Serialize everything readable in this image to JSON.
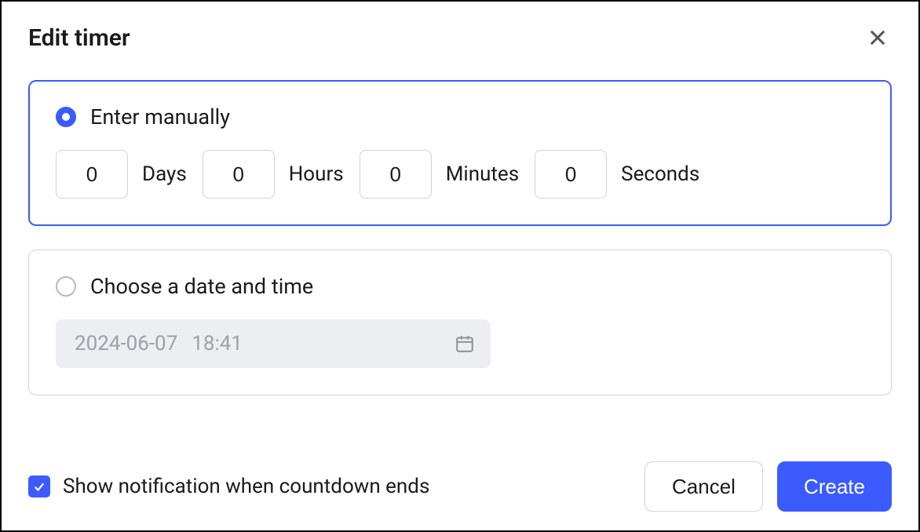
{
  "dialog": {
    "title": "Edit timer"
  },
  "manual": {
    "label": "Enter manually",
    "selected": true,
    "days": {
      "value": "0",
      "label": "Days"
    },
    "hours": {
      "value": "0",
      "label": "Hours"
    },
    "minutes": {
      "value": "0",
      "label": "Minutes"
    },
    "seconds": {
      "value": "0",
      "label": "Seconds"
    }
  },
  "datetime": {
    "label": "Choose a date and time",
    "selected": false,
    "date": "2024-06-07",
    "time": "18:41"
  },
  "notification": {
    "label": "Show notification when countdown ends",
    "checked": true
  },
  "buttons": {
    "cancel": "Cancel",
    "create": "Create"
  }
}
